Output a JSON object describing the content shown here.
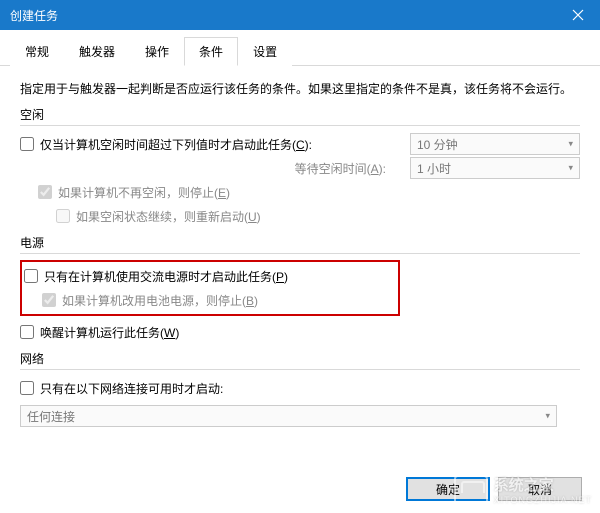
{
  "window": {
    "title": "创建任务"
  },
  "tabs": {
    "items": [
      "常规",
      "触发器",
      "操作",
      "条件",
      "设置"
    ],
    "active": "条件"
  },
  "description": "指定用于与触发器一起判断是否应运行该任务的条件。如果这里指定的条件不是真，该任务将不会运行。",
  "sections": {
    "idle": {
      "label": "空闲",
      "start_if_idle": {
        "text_pre": "仅当计算机空闲时间超过下列值时才启动此任务(",
        "key": "C",
        "text_post": "):",
        "checked": false
      },
      "idle_duration": "10 分钟",
      "wait_label_pre": "等待空闲时间(",
      "wait_key": "A",
      "wait_label_post": "):",
      "wait_duration": "1 小时",
      "stop_if_not_idle": {
        "text_pre": "如果计算机不再空闲，则停止(",
        "key": "E",
        "text_post": ")",
        "checked": true
      },
      "restart_on_idle": {
        "text_pre": "如果空闲状态继续，则重新启动(",
        "key": "U",
        "text_post": ")",
        "checked": false
      }
    },
    "power": {
      "label": "电源",
      "ac_only": {
        "text_pre": "只有在计算机使用交流电源时才启动此任务(",
        "key": "P",
        "text_post": ")",
        "checked": false
      },
      "stop_on_battery": {
        "text_pre": "如果计算机改用电池电源，则停止(",
        "key": "B",
        "text_post": ")",
        "checked": true
      },
      "wake": {
        "text_pre": "唤醒计算机运行此任务(",
        "key": "W",
        "text_post": ")",
        "checked": false
      }
    },
    "network": {
      "label": "网络",
      "only_if_network": {
        "text": "只有在以下网络连接可用时才启动:",
        "checked": false
      },
      "selected": "任何连接"
    }
  },
  "buttons": {
    "ok": "确定",
    "cancel": "取消"
  },
  "watermark": {
    "name": "系统之家",
    "url": "XITONGZHIJIA.NET"
  }
}
